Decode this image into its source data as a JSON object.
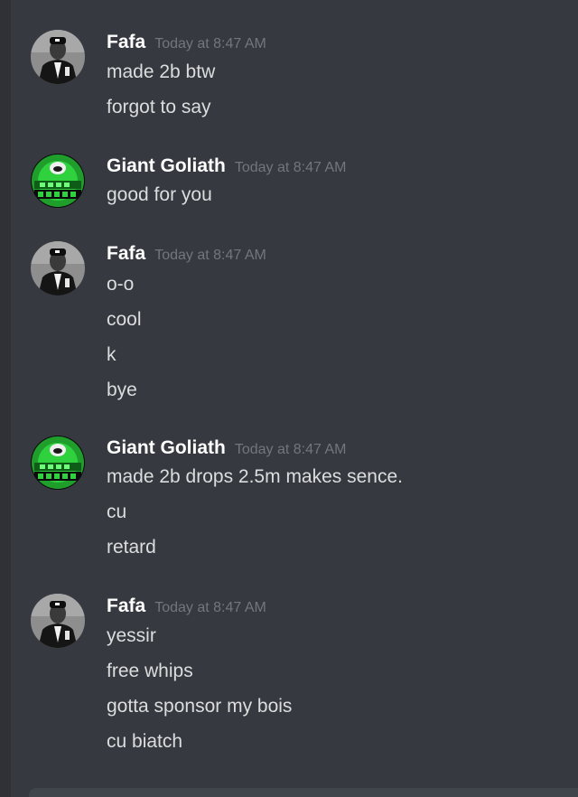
{
  "colors": {
    "background": "#36393f",
    "username": "#ffffff",
    "timestamp": "#72767d",
    "message_text": "#dcddde"
  },
  "messages": [
    {
      "author": "Fafa",
      "avatar_icon": "fafa-avatar-icon",
      "timestamp": "Today at 8:47 AM",
      "lines": [
        "made 2b btw",
        "forgot to say"
      ]
    },
    {
      "author": "Giant Goliath",
      "avatar_icon": "giant-goliath-avatar-icon",
      "timestamp": "Today at 8:47 AM",
      "lines": [
        "good for you"
      ]
    },
    {
      "author": "Fafa",
      "avatar_icon": "fafa-avatar-icon",
      "timestamp": "Today at 8:47 AM",
      "lines": [
        "o-o",
        "cool",
        "k",
        "bye"
      ]
    },
    {
      "author": "Giant Goliath",
      "avatar_icon": "giant-goliath-avatar-icon",
      "timestamp": "Today at 8:47 AM",
      "lines": [
        "made 2b drops 2.5m makes sence.",
        "cu",
        "retard"
      ]
    },
    {
      "author": "Fafa",
      "avatar_icon": "fafa-avatar-icon",
      "timestamp": "Today at 8:47 AM",
      "lines": [
        "yessir",
        "free whips",
        "gotta sponsor my bois",
        "cu biatch"
      ]
    }
  ]
}
